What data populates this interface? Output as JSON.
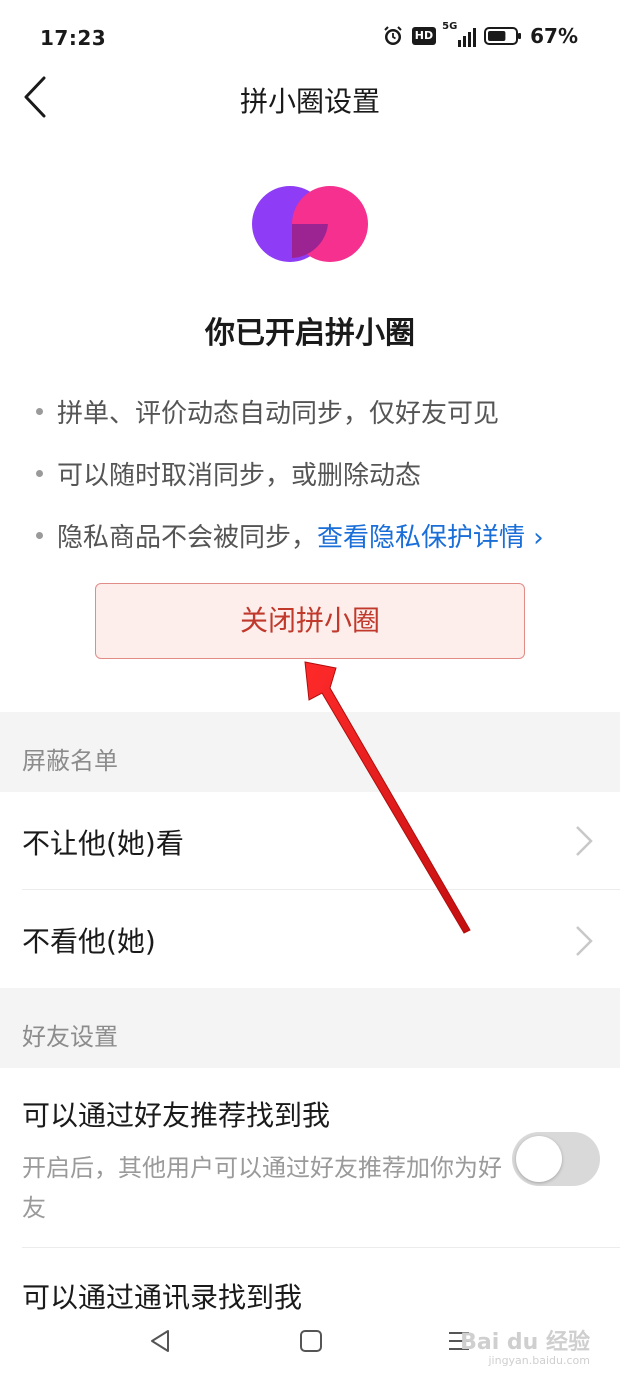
{
  "status_bar": {
    "time": "17:23",
    "icons": [
      "alarm-icon",
      "hd-icon",
      "5g-signal-icon",
      "battery-icon"
    ],
    "hd_label": "HD",
    "network_label": "5G",
    "battery_percent": "67%",
    "battery_level": 0.67
  },
  "nav": {
    "title": "拼小圈设置",
    "back_icon": "chevron-left-icon"
  },
  "hero": {
    "logo_icon": "overlapping-circles-logo",
    "title": "你已开启拼小圈",
    "bullets": [
      "拼单、评价动态自动同步，仅好友可见",
      "可以随时取消同步，或删除动态",
      "隐私商品不会被同步，"
    ],
    "privacy_link": "查看隐私保护详情 ›"
  },
  "close_button": {
    "label": "关闭拼小圈"
  },
  "block_list": {
    "header": "屏蔽名单",
    "items": [
      {
        "label": "不让他(她)看"
      },
      {
        "label": "不看他(她)"
      }
    ]
  },
  "friend_settings": {
    "header": "好友设置",
    "items": [
      {
        "label": "可以通过好友推荐找到我",
        "description": "开启后，其他用户可以通过好友推荐加你为好友",
        "enabled": false
      },
      {
        "label": "可以通过通讯录找到我"
      }
    ]
  },
  "system_nav": {
    "buttons": [
      "back-triangle-icon",
      "home-square-icon",
      "menu-lines-icon"
    ]
  },
  "watermark": {
    "text": "Bai du 经验",
    "sub": "jingyan.baidu.com"
  },
  "colors": {
    "accent_link": "#1a6ed8",
    "close_text": "#c0392b",
    "close_bg": "#fdeeec",
    "logo_purple": "#8e3cf5",
    "logo_pink": "#f5308e",
    "annotation_arrow": "#e01b1b"
  }
}
